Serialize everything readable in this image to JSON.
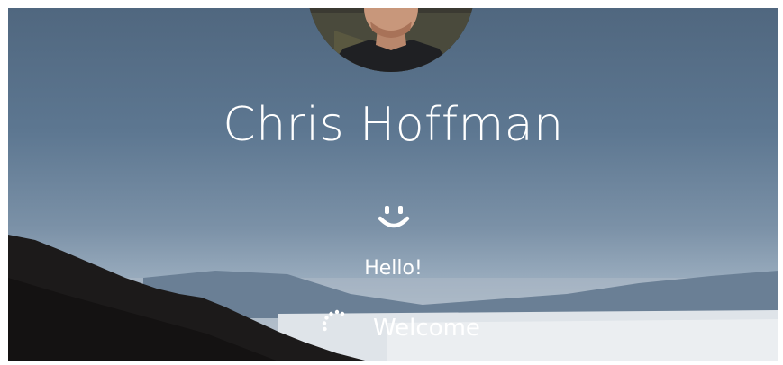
{
  "user": {
    "name": "Chris Hoffman"
  },
  "status": {
    "greeting": "Hello!",
    "message": "Welcome"
  },
  "icons": {
    "face": "smiley-face-icon",
    "progress": "loading-spinner-icon"
  },
  "colors": {
    "text": "#ffffff",
    "sky_top": "#50677f",
    "ground": "#1c1a1a"
  }
}
